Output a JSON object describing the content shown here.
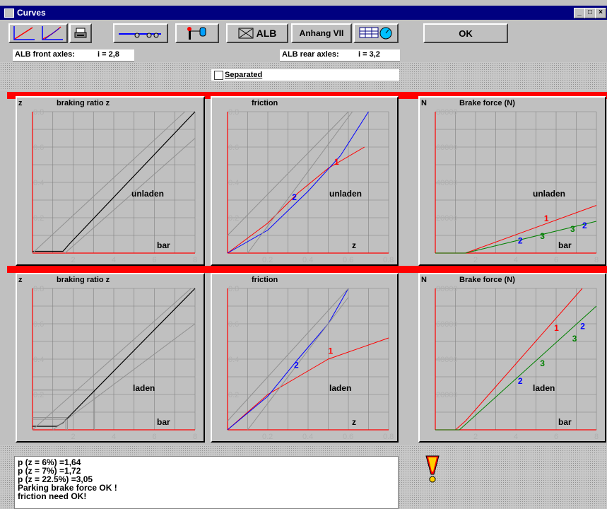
{
  "window": {
    "title": "Curves",
    "minimize": "_",
    "maximize": "□",
    "close": "×"
  },
  "toolbar": {
    "curve1_icon": "curve-linear-icon",
    "curve2_icon": "curve-ratio-icon",
    "print_icon": "printer-icon",
    "trailer_icon": "trailer-icon",
    "valve_icon": "valve-icon",
    "alb_label": "ALB",
    "anhang_label": "Anhang VII",
    "table_icon": "table-gauge-icon",
    "ok_label": "OK"
  },
  "alb": {
    "front_label": "ALB front axles:",
    "front_value": "i = 2,8",
    "rear_label": "ALB rear axles:",
    "rear_value": "i = 3,2"
  },
  "separated_label": "Separated",
  "panels": {
    "row1": [
      {
        "ylab": "z",
        "title": "braking ratio z",
        "note": "unladen",
        "xunit": "bar"
      },
      {
        "ylab": "",
        "title": "friction",
        "note": "unladen",
        "xunit": "z"
      },
      {
        "ylab": "N",
        "title": "Brake force (N)",
        "note": "unladen",
        "xunit": "bar"
      }
    ],
    "row2": [
      {
        "ylab": "z",
        "title": "braking ratio z",
        "note": "laden",
        "xunit": "bar"
      },
      {
        "ylab": "",
        "title": "friction",
        "note": "laden",
        "xunit": "z"
      },
      {
        "ylab": "N",
        "title": "Brake force (N)",
        "note": "laden",
        "xunit": "bar"
      }
    ]
  },
  "ticks": {
    "bar_x": [
      "2",
      "4",
      "6",
      "8"
    ],
    "z_x": [
      "0.2",
      "0.4",
      "0.6",
      "0.8"
    ],
    "ratio_y": [
      "0.8",
      "0.6",
      "0.4",
      "0.2"
    ],
    "force_y": [
      "80000",
      "60000",
      "40000",
      "20000"
    ]
  },
  "series_labels": {
    "s1": "1",
    "s2": "2",
    "s3": "3"
  },
  "colors": {
    "red": "#ff0000",
    "blue": "#0000ff",
    "green": "#008000",
    "grid": "#808080",
    "band": "#ff0000",
    "title": "#000080"
  },
  "status": [
    "p (z = 6%) =1,64",
    "p (z = 7%) =1,72",
    "p (z = 22.5%) =3,05",
    "Parking brake force OK !",
    "friction need OK!"
  ],
  "warning_icon": "warning-exclamation-icon"
}
